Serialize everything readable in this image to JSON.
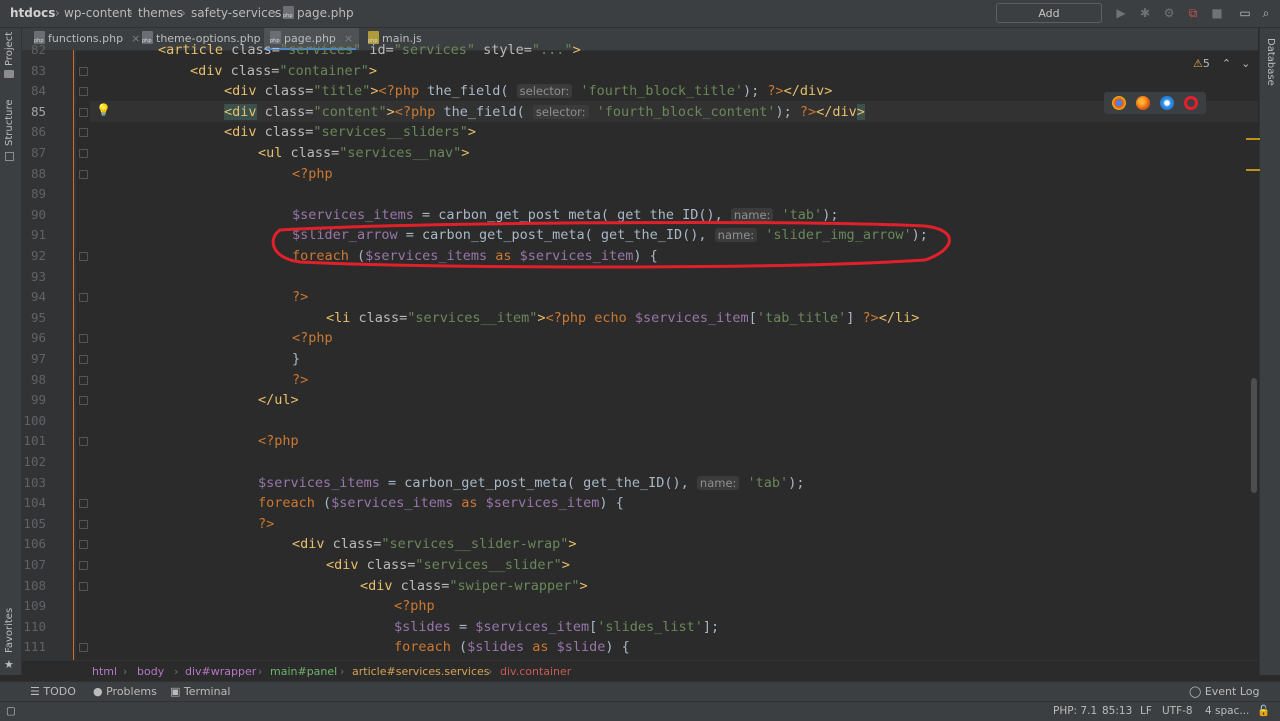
{
  "navbar": {
    "crumbs": [
      "htdocs",
      "wp-content",
      "themes",
      "safety-services",
      "page.php"
    ],
    "add_config": "Add Configuration..."
  },
  "tabs": [
    {
      "label": "functions.php"
    },
    {
      "label": "theme-options.php"
    },
    {
      "label": "page.php"
    },
    {
      "label": "main.js"
    }
  ],
  "left_strip": {
    "project": "Project",
    "structure": "Structure",
    "favorites": "Favorites"
  },
  "right_strip": {
    "database": "Database"
  },
  "editor": {
    "warnings_count": "5",
    "line_numbers": [
      "82",
      "83",
      "84",
      "85",
      "86",
      "87",
      "88",
      "89",
      "90",
      "91",
      "92",
      "93",
      "94",
      "95",
      "96",
      "97",
      "98",
      "99",
      "100",
      "101",
      "102",
      "103",
      "104",
      "105",
      "106",
      "107",
      "108",
      "109",
      "110",
      "111"
    ],
    "current_line": "85",
    "hints": {
      "selector": "selector:",
      "name": "name:"
    }
  },
  "breadcrumb": [
    "html",
    "body",
    "div#wrapper",
    "main#panel",
    "article#services.services",
    "div.container"
  ],
  "toolwindows": {
    "todo": "TODO",
    "problems": "Problems",
    "terminal": "Terminal",
    "event_log": "Event Log"
  },
  "status": {
    "php": "PHP: 7.1",
    "position": "85:13",
    "line_sep": "LF",
    "encoding": "UTF-8",
    "indent": "4 spac..."
  },
  "colors": {
    "accent": "#4a88c7",
    "annotation": "#e0202a"
  }
}
